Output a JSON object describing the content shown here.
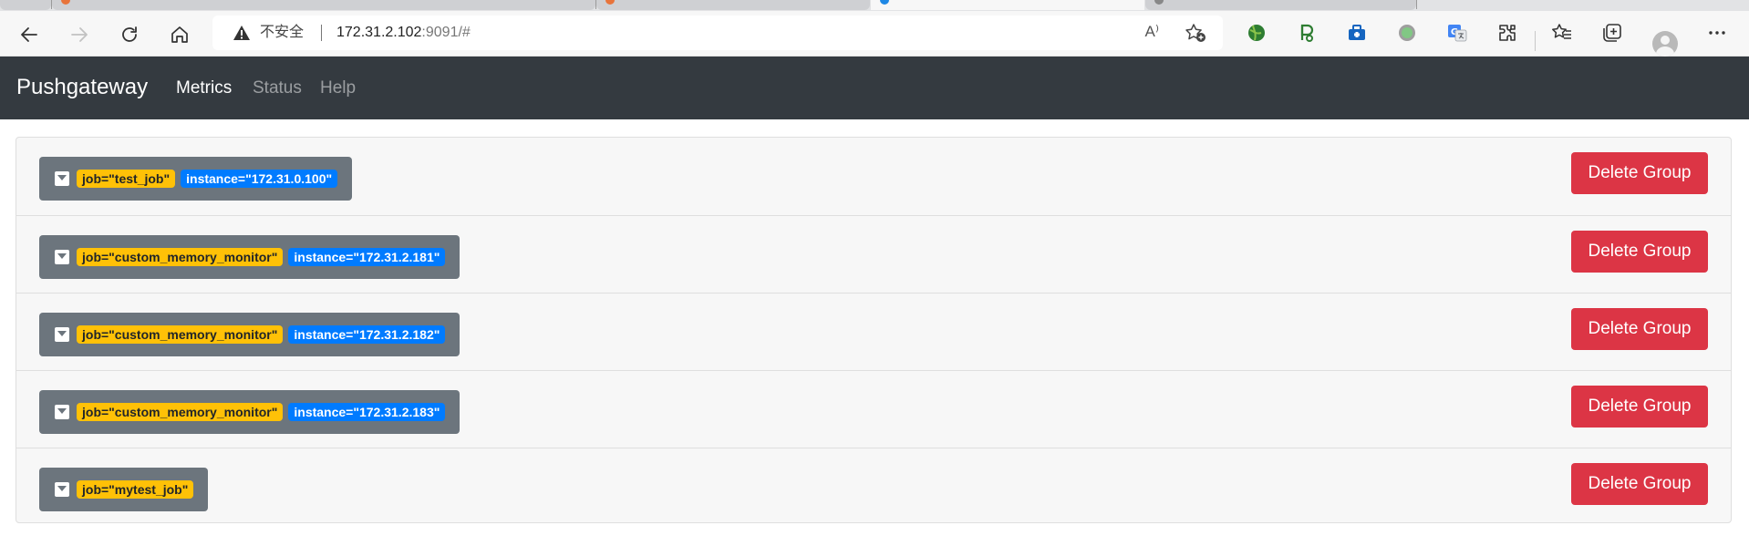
{
  "browser": {
    "address": {
      "security_label": "不安全",
      "host": "172.31.2.102",
      "port_path": ":9091/#"
    },
    "read_aloud_glyph": "A⁾",
    "icons": [
      "back-icon",
      "forward-icon",
      "refresh-icon",
      "home-icon",
      "warning-icon",
      "favorite-add-icon",
      "extension-icon",
      "favorites-icon",
      "collections-icon",
      "profile-icon",
      "more-icon"
    ]
  },
  "navbar": {
    "brand": "Pushgateway",
    "links": [
      "Metrics",
      "Status",
      "Help"
    ],
    "active": "Metrics",
    "colors": {
      "background": "#343a40"
    }
  },
  "groups": [
    {
      "job": "job=\"test_job\"",
      "instance": "instance=\"172.31.0.100\"",
      "delete_label": "Delete Group"
    },
    {
      "job": "job=\"custom_memory_monitor\"",
      "instance": "instance=\"172.31.2.181\"",
      "delete_label": "Delete Group"
    },
    {
      "job": "job=\"custom_memory_monitor\"",
      "instance": "instance=\"172.31.2.182\"",
      "delete_label": "Delete Group"
    },
    {
      "job": "job=\"custom_memory_monitor\"",
      "instance": "instance=\"172.31.2.183\"",
      "delete_label": "Delete Group"
    },
    {
      "job": "job=\"mytest_job\"",
      "instance": null,
      "delete_label": "Delete Group"
    }
  ],
  "colors": {
    "job_badge": "#ffc107",
    "instance_badge": "#007bff",
    "group_label_bg": "#6c757d",
    "delete_button": "#dc3545"
  }
}
